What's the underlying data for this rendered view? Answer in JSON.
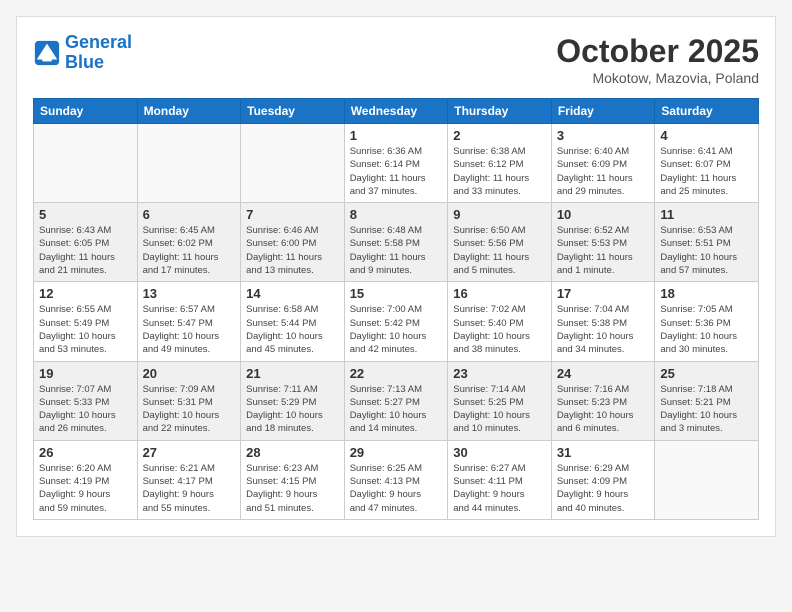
{
  "header": {
    "logo_line1": "General",
    "logo_line2": "Blue",
    "month": "October 2025",
    "location": "Mokotow, Mazovia, Poland"
  },
  "days_of_week": [
    "Sunday",
    "Monday",
    "Tuesday",
    "Wednesday",
    "Thursday",
    "Friday",
    "Saturday"
  ],
  "weeks": [
    [
      {
        "day": "",
        "info": ""
      },
      {
        "day": "",
        "info": ""
      },
      {
        "day": "",
        "info": ""
      },
      {
        "day": "1",
        "info": "Sunrise: 6:36 AM\nSunset: 6:14 PM\nDaylight: 11 hours\nand 37 minutes."
      },
      {
        "day": "2",
        "info": "Sunrise: 6:38 AM\nSunset: 6:12 PM\nDaylight: 11 hours\nand 33 minutes."
      },
      {
        "day": "3",
        "info": "Sunrise: 6:40 AM\nSunset: 6:09 PM\nDaylight: 11 hours\nand 29 minutes."
      },
      {
        "day": "4",
        "info": "Sunrise: 6:41 AM\nSunset: 6:07 PM\nDaylight: 11 hours\nand 25 minutes."
      }
    ],
    [
      {
        "day": "5",
        "info": "Sunrise: 6:43 AM\nSunset: 6:05 PM\nDaylight: 11 hours\nand 21 minutes."
      },
      {
        "day": "6",
        "info": "Sunrise: 6:45 AM\nSunset: 6:02 PM\nDaylight: 11 hours\nand 17 minutes."
      },
      {
        "day": "7",
        "info": "Sunrise: 6:46 AM\nSunset: 6:00 PM\nDaylight: 11 hours\nand 13 minutes."
      },
      {
        "day": "8",
        "info": "Sunrise: 6:48 AM\nSunset: 5:58 PM\nDaylight: 11 hours\nand 9 minutes."
      },
      {
        "day": "9",
        "info": "Sunrise: 6:50 AM\nSunset: 5:56 PM\nDaylight: 11 hours\nand 5 minutes."
      },
      {
        "day": "10",
        "info": "Sunrise: 6:52 AM\nSunset: 5:53 PM\nDaylight: 11 hours\nand 1 minute."
      },
      {
        "day": "11",
        "info": "Sunrise: 6:53 AM\nSunset: 5:51 PM\nDaylight: 10 hours\nand 57 minutes."
      }
    ],
    [
      {
        "day": "12",
        "info": "Sunrise: 6:55 AM\nSunset: 5:49 PM\nDaylight: 10 hours\nand 53 minutes."
      },
      {
        "day": "13",
        "info": "Sunrise: 6:57 AM\nSunset: 5:47 PM\nDaylight: 10 hours\nand 49 minutes."
      },
      {
        "day": "14",
        "info": "Sunrise: 6:58 AM\nSunset: 5:44 PM\nDaylight: 10 hours\nand 45 minutes."
      },
      {
        "day": "15",
        "info": "Sunrise: 7:00 AM\nSunset: 5:42 PM\nDaylight: 10 hours\nand 42 minutes."
      },
      {
        "day": "16",
        "info": "Sunrise: 7:02 AM\nSunset: 5:40 PM\nDaylight: 10 hours\nand 38 minutes."
      },
      {
        "day": "17",
        "info": "Sunrise: 7:04 AM\nSunset: 5:38 PM\nDaylight: 10 hours\nand 34 minutes."
      },
      {
        "day": "18",
        "info": "Sunrise: 7:05 AM\nSunset: 5:36 PM\nDaylight: 10 hours\nand 30 minutes."
      }
    ],
    [
      {
        "day": "19",
        "info": "Sunrise: 7:07 AM\nSunset: 5:33 PM\nDaylight: 10 hours\nand 26 minutes."
      },
      {
        "day": "20",
        "info": "Sunrise: 7:09 AM\nSunset: 5:31 PM\nDaylight: 10 hours\nand 22 minutes."
      },
      {
        "day": "21",
        "info": "Sunrise: 7:11 AM\nSunset: 5:29 PM\nDaylight: 10 hours\nand 18 minutes."
      },
      {
        "day": "22",
        "info": "Sunrise: 7:13 AM\nSunset: 5:27 PM\nDaylight: 10 hours\nand 14 minutes."
      },
      {
        "day": "23",
        "info": "Sunrise: 7:14 AM\nSunset: 5:25 PM\nDaylight: 10 hours\nand 10 minutes."
      },
      {
        "day": "24",
        "info": "Sunrise: 7:16 AM\nSunset: 5:23 PM\nDaylight: 10 hours\nand 6 minutes."
      },
      {
        "day": "25",
        "info": "Sunrise: 7:18 AM\nSunset: 5:21 PM\nDaylight: 10 hours\nand 3 minutes."
      }
    ],
    [
      {
        "day": "26",
        "info": "Sunrise: 6:20 AM\nSunset: 4:19 PM\nDaylight: 9 hours\nand 59 minutes."
      },
      {
        "day": "27",
        "info": "Sunrise: 6:21 AM\nSunset: 4:17 PM\nDaylight: 9 hours\nand 55 minutes."
      },
      {
        "day": "28",
        "info": "Sunrise: 6:23 AM\nSunset: 4:15 PM\nDaylight: 9 hours\nand 51 minutes."
      },
      {
        "day": "29",
        "info": "Sunrise: 6:25 AM\nSunset: 4:13 PM\nDaylight: 9 hours\nand 47 minutes."
      },
      {
        "day": "30",
        "info": "Sunrise: 6:27 AM\nSunset: 4:11 PM\nDaylight: 9 hours\nand 44 minutes."
      },
      {
        "day": "31",
        "info": "Sunrise: 6:29 AM\nSunset: 4:09 PM\nDaylight: 9 hours\nand 40 minutes."
      },
      {
        "day": "",
        "info": ""
      }
    ]
  ]
}
